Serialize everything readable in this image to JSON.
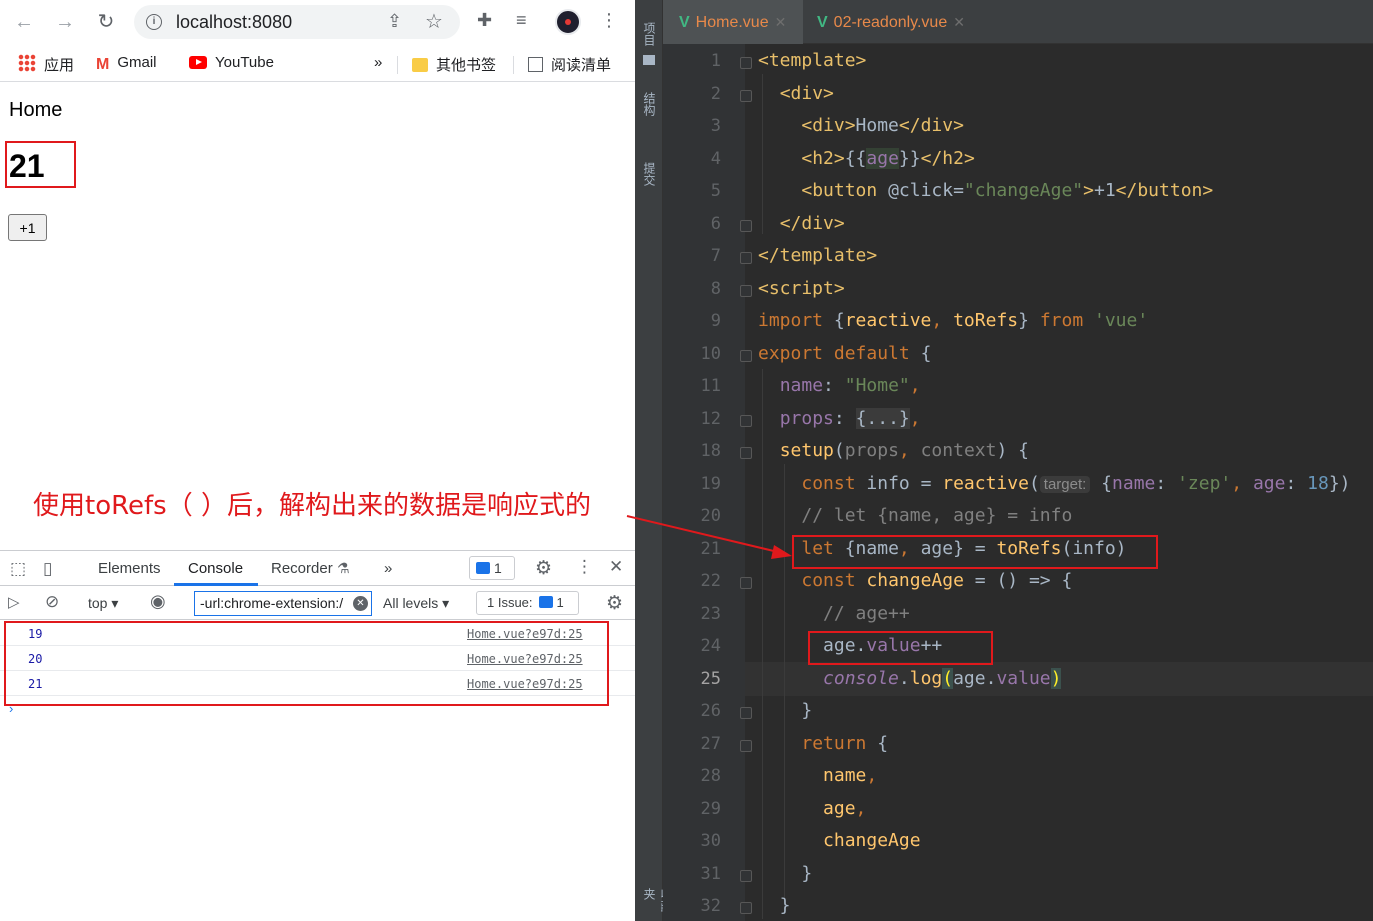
{
  "browser": {
    "url": "localhost:8080",
    "bookmarks": [
      "应用",
      "Gmail",
      "YouTube",
      "»",
      "其他书签",
      "阅读清单"
    ],
    "page": {
      "heading": "Home",
      "age": "21",
      "button_label": "+1"
    }
  },
  "annotation": "使用toRefs（ ）后，解构出来的数据是响应式的",
  "devtools": {
    "tabs": [
      "Elements",
      "Console",
      "Recorder",
      "»"
    ],
    "active_tab": "Console",
    "message_count": "1",
    "context": "top",
    "filter_value": "-url:chrome-extension:/",
    "levels": "All levels",
    "issues": "1 Issue:",
    "issues_count": "1",
    "log": [
      {
        "value": "19",
        "source": "Home.vue?e97d:25"
      },
      {
        "value": "20",
        "source": "Home.vue?e97d:25"
      },
      {
        "value": "21",
        "source": "Home.vue?e97d:25"
      }
    ],
    "prompt": "›"
  },
  "ide": {
    "side_labels": [
      "项目",
      "结构",
      "提交",
      "收藏夹"
    ],
    "tabs": [
      {
        "name": "Home.vue",
        "active": true
      },
      {
        "name": "02-readonly.vue",
        "active": false
      }
    ],
    "line_numbers": [
      "1",
      "2",
      "3",
      "4",
      "5",
      "6",
      "7",
      "8",
      "9",
      "10",
      "11",
      "12",
      "18",
      "19",
      "20",
      "21",
      "22",
      "23",
      "24",
      "25",
      "26",
      "27",
      "28",
      "29",
      "30",
      "31",
      "32"
    ],
    "current_line": "25",
    "param_hint": "target:"
  },
  "colors": {
    "annotation_red": "#e0191c",
    "ide_bg": "#2b2b2b",
    "keyword": "#cc7832",
    "string": "#6a8759",
    "property": "#9876aa",
    "function": "#ffc66d",
    "tag": "#e8bf6a"
  }
}
